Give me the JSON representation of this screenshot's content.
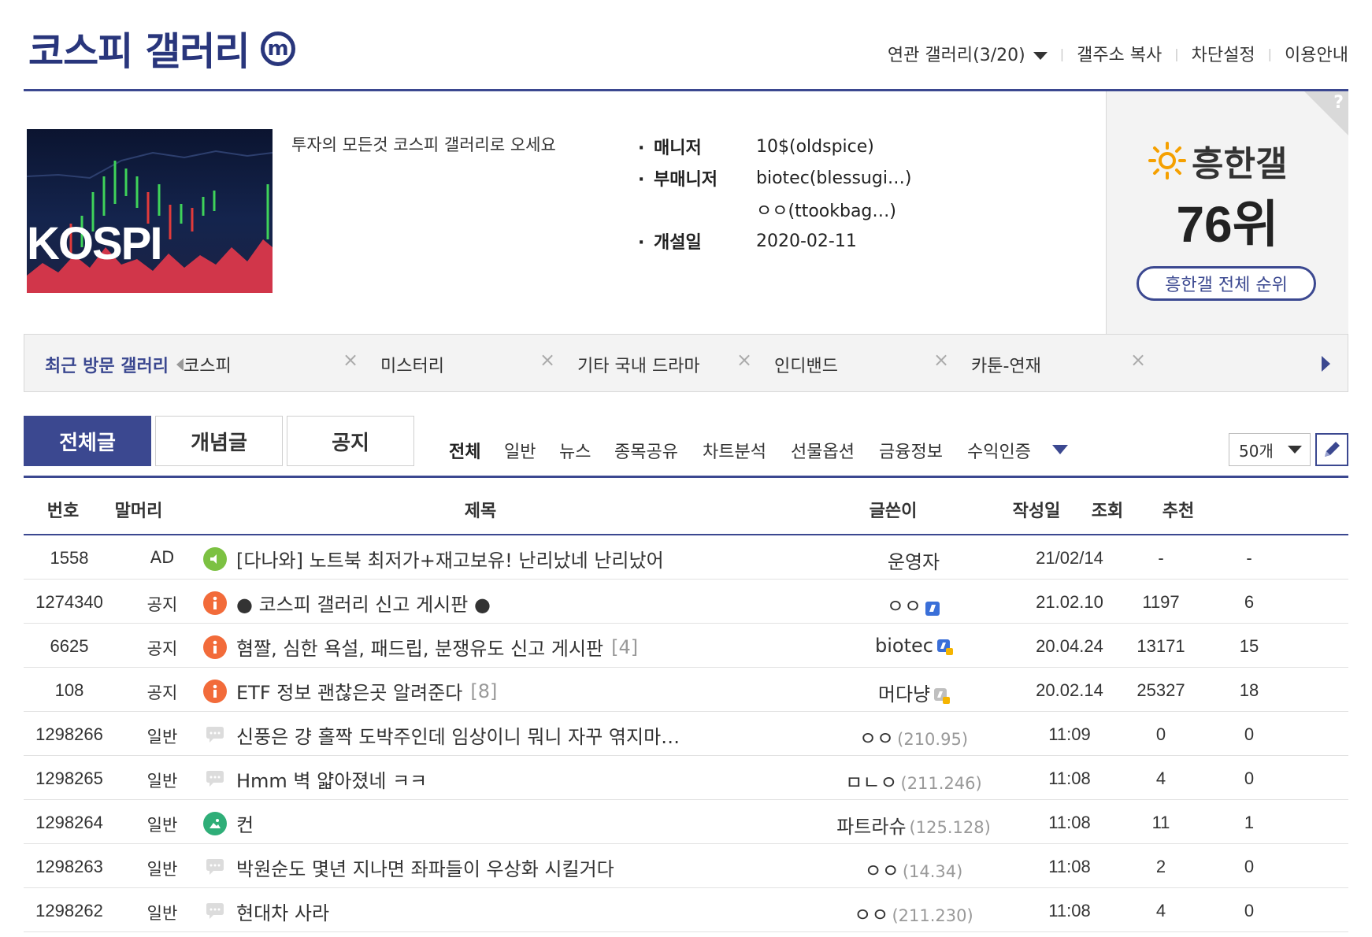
{
  "header": {
    "title": "코스피 갤러리",
    "mobile_icon": "m",
    "links": [
      "연관 갤러리(3/20)",
      "갤주소 복사",
      "차단설정",
      "이용안내"
    ]
  },
  "info": {
    "image_label": "KOSPI",
    "intro": "투자의 모든것 코스피 갤러리로 오세요",
    "manager_label": "매니저",
    "manager": "10$(oldspice)",
    "sub_manager_label": "부매니저",
    "sub_managers": [
      "biotec(blessugi…)",
      "ㅇㅇ(ttookbag…)"
    ],
    "opened_label": "개설일",
    "opened": "2020-02-11"
  },
  "rank": {
    "corner_mark": "?",
    "title": "흥한갤",
    "value": "76위",
    "button": "흥한갤 전체 순위"
  },
  "recent": {
    "label": "최근 방문 갤러리",
    "items": [
      "코스피",
      "미스터리",
      "기타 국내 드라마",
      "인디밴드",
      "카툰-연재"
    ],
    "close_glyph": "×"
  },
  "tabs": [
    "전체글",
    "개념글",
    "공지"
  ],
  "categories": [
    "전체",
    "일반",
    "뉴스",
    "종목공유",
    "차트분석",
    "선물옵션",
    "금융정보",
    "수익인증"
  ],
  "per_page": "50개",
  "table": {
    "headers": {
      "num": "번호",
      "head": "말머리",
      "title": "제목",
      "writer": "글쓴이",
      "date": "작성일",
      "views": "조회",
      "rec": "추천"
    },
    "rows": [
      {
        "num": "1558",
        "head": "AD",
        "icon": "speaker-icon",
        "title": "[다나와] 노트북 최저가+재고보유! 난리났네 난리났어",
        "replies": "",
        "writer": "운영자",
        "ip": "",
        "date": "21/02/14",
        "views": "-",
        "rec": "-"
      },
      {
        "num": "1274340",
        "head": "공지",
        "icon": "info-icon",
        "title": "● 코스피 갤러리 신고 게시판 ●",
        "replies": "",
        "writer": "ㅇㅇ",
        "ip": "",
        "date": "21.02.10",
        "views": "1197",
        "rec": "6"
      },
      {
        "num": "6625",
        "head": "공지",
        "icon": "info-icon",
        "title": "혐짤, 심한 욕설, 패드립, 분쟁유도 신고 게시판",
        "replies": "[4]",
        "writer": "biotec",
        "ip": "",
        "date": "20.04.24",
        "views": "13171",
        "rec": "15"
      },
      {
        "num": "108",
        "head": "공지",
        "icon": "info-icon",
        "title": "ETF 정보 괜찮은곳 알려준다",
        "replies": "[8]",
        "writer": "머다냥",
        "ip": "",
        "date": "20.02.14",
        "views": "25327",
        "rec": "18"
      },
      {
        "num": "1298266",
        "head": "일반",
        "icon": "speech-bubble-icon",
        "title": "신풍은 걍 홀짝 도박주인데 임상이니 뭐니 자꾸 엮지마…",
        "replies": "",
        "writer": "ㅇㅇ",
        "ip": "(210.95)",
        "date": "11:09",
        "views": "0",
        "rec": "0"
      },
      {
        "num": "1298265",
        "head": "일반",
        "icon": "speech-bubble-icon",
        "title": "Hmm 벽 얇아졌네 ㅋㅋ",
        "replies": "",
        "writer": "ㅁㄴㅇ",
        "ip": "(211.246)",
        "date": "11:08",
        "views": "4",
        "rec": "0"
      },
      {
        "num": "1298264",
        "head": "일반",
        "icon": "image-icon",
        "title": "컨",
        "replies": "",
        "writer": "파트라슈",
        "ip": "(125.128)",
        "date": "11:08",
        "views": "11",
        "rec": "1"
      },
      {
        "num": "1298263",
        "head": "일반",
        "icon": "speech-bubble-icon",
        "title": "박원순도 몇년 지나면 좌파들이 우상화 시킬거다",
        "replies": "",
        "writer": "ㅇㅇ",
        "ip": "(14.34)",
        "date": "11:08",
        "views": "2",
        "rec": "0"
      },
      {
        "num": "1298262",
        "head": "일반",
        "icon": "speech-bubble-icon",
        "title": "현대차 사라",
        "replies": "",
        "writer": "ㅇㅇ",
        "ip": "(211.230)",
        "date": "11:08",
        "views": "4",
        "rec": "0"
      }
    ]
  },
  "colors": {
    "brand": "#3b4890",
    "title": "#29367c",
    "notice_icon": "#f26b3a",
    "ad_icon": "#7cc142",
    "image_icon": "#2fae78"
  }
}
